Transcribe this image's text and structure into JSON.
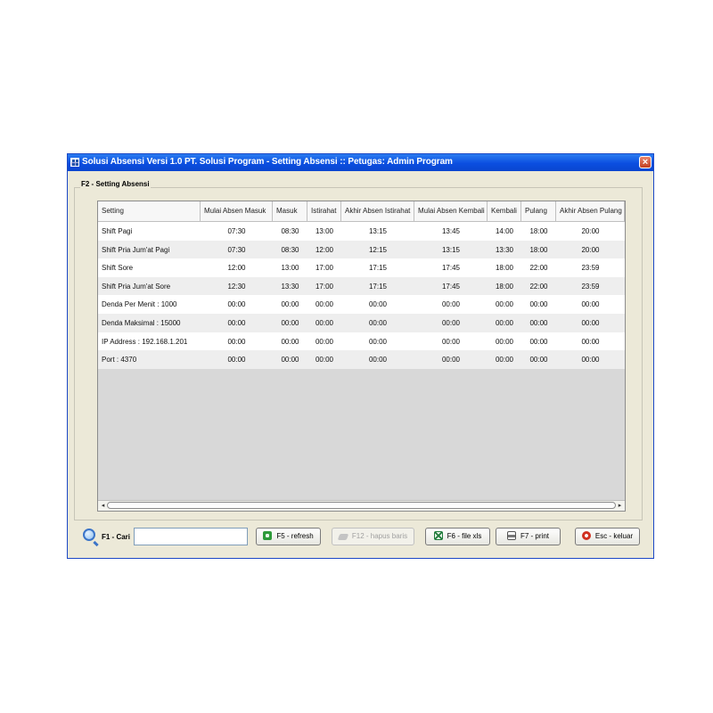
{
  "window": {
    "title": "Solusi Absensi Versi 1.0 PT. Solusi Program    - Setting Absensi   ::   Petugas: Admin Program",
    "close_label": "×"
  },
  "panel": {
    "title": "F2 - Setting Absensi"
  },
  "table": {
    "columns": [
      "Setting",
      "Mulai Absen Masuk",
      "Masuk",
      "Istirahat",
      "Akhir Absen Istirahat",
      "Mulai Absen Kembali",
      "Kembali",
      "Pulang",
      "Akhir Absen Pulang"
    ],
    "rows": [
      [
        "Shift Pagi",
        "07:30",
        "08:30",
        "13:00",
        "13:15",
        "13:45",
        "14:00",
        "18:00",
        "20:00"
      ],
      [
        "Shift Pria Jum'at Pagi",
        "07:30",
        "08:30",
        "12:00",
        "12:15",
        "13:15",
        "13:30",
        "18:00",
        "20:00"
      ],
      [
        "Shift Sore",
        "12:00",
        "13:00",
        "17:00",
        "17:15",
        "17:45",
        "18:00",
        "22:00",
        "23:59"
      ],
      [
        "Shift Pria Jum'at Sore",
        "12:30",
        "13:30",
        "17:00",
        "17:15",
        "17:45",
        "18:00",
        "22:00",
        "23:59"
      ],
      [
        "Denda Per Menit : 1000",
        "00:00",
        "00:00",
        "00:00",
        "00:00",
        "00:00",
        "00:00",
        "00:00",
        "00:00"
      ],
      [
        "Denda Maksimal : 15000",
        "00:00",
        "00:00",
        "00:00",
        "00:00",
        "00:00",
        "00:00",
        "00:00",
        "00:00"
      ],
      [
        "IP Address : 192.168.1.201",
        "00:00",
        "00:00",
        "00:00",
        "00:00",
        "00:00",
        "00:00",
        "00:00",
        "00:00"
      ],
      [
        "Port : 4370",
        "00:00",
        "00:00",
        "00:00",
        "00:00",
        "00:00",
        "00:00",
        "00:00",
        "00:00"
      ]
    ]
  },
  "scrollbar": {
    "left_arrow": "◂",
    "right_arrow": "▸"
  },
  "search": {
    "label": "F1 - Cari",
    "value": "",
    "placeholder": ""
  },
  "buttons": {
    "refresh": "F5 - refresh",
    "delete_row": "F12 - hapus baris",
    "export_xls": "F6 - file xls",
    "print": "F7 - print",
    "exit": "Esc - keluar"
  },
  "icons": {
    "app": "app-icon",
    "close": "close-icon",
    "search": "magnifier-icon",
    "refresh": "refresh-icon",
    "delete": "eraser-icon",
    "excel": "excel-icon",
    "print": "printer-icon",
    "exit": "exit-icon"
  },
  "colors": {
    "titlebar": "#0b4ee0",
    "window_border": "#1c48c6",
    "refresh_icon": "#2e9a3a",
    "exit_icon": "#d03020",
    "excel_icon": "#1f7a3a"
  }
}
